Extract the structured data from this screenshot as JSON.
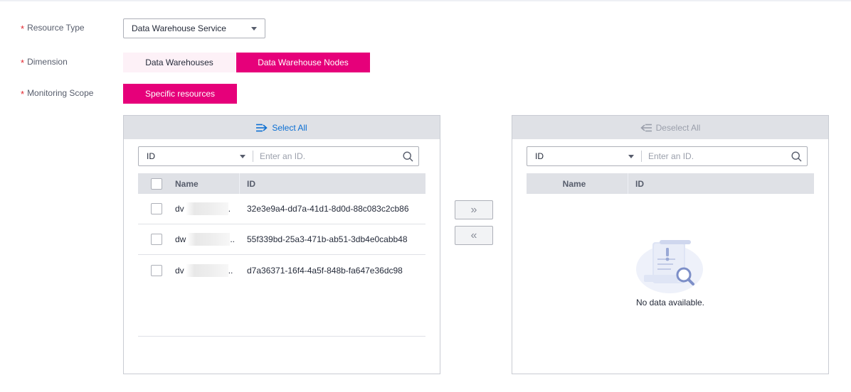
{
  "form": {
    "resource_type": {
      "label": "Resource Type",
      "required_mark": "*",
      "value": "Data Warehouse Service"
    },
    "dimension": {
      "label": "Dimension",
      "required_mark": "*",
      "options": [
        "Data Warehouses",
        "Data Warehouse Nodes"
      ],
      "selected": "Data Warehouse Nodes"
    },
    "monitoring_scope": {
      "label": "Monitoring Scope",
      "required_mark": "*",
      "value": "Specific resources"
    }
  },
  "left_panel": {
    "action": "Select All",
    "search_type": "ID",
    "search_placeholder": "Enter an ID.",
    "columns": {
      "name": "Name",
      "id": "ID"
    },
    "rows": [
      {
        "name": "dv",
        "name_suffix": ".",
        "id": "32e3e9a4-dd7a-41d1-8d0d-88c083c2cb86"
      },
      {
        "name": "dw",
        "name_suffix": "..",
        "id": "55f339bd-25a3-471b-ab51-3db4e0cabb48"
      },
      {
        "name": "dv",
        "name_suffix": "..",
        "id": "d7a36371-16f4-4a5f-848b-fa647e36dc98"
      }
    ]
  },
  "right_panel": {
    "action": "Deselect All",
    "search_type": "ID",
    "search_placeholder": "Enter an ID.",
    "columns": {
      "name": "Name",
      "id": "ID"
    },
    "empty_text": "No data available."
  },
  "move_buttons": {
    "add": "»",
    "remove": "«"
  },
  "colors": {
    "accent": "#e6007a",
    "link": "#0c6fd3",
    "required": "#e2262e"
  }
}
